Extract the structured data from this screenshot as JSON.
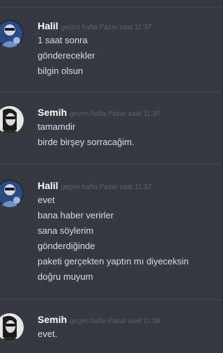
{
  "messages": [
    {
      "username": "Halil",
      "timestamp": "geçen hafta Pazar saat 11:37",
      "avatar_icon": "halil-avatar-icon",
      "lines": [
        "1 saat sonra",
        "gönderecekler",
        "bilgin olsun"
      ]
    },
    {
      "username": "Semih",
      "timestamp": "geçen hafta Pazar saat 11:37",
      "avatar_icon": "semih-avatar-icon",
      "lines": [
        "tamamdir",
        "birde birşey sorracağim."
      ]
    },
    {
      "username": "Halil",
      "timestamp": "geçen hafta Pazar saat 11:37",
      "avatar_icon": "halil-avatar-icon",
      "lines": [
        "evet",
        "bana haber verirler",
        "sana söylerim",
        "gönderdiğinde",
        "paketi gerçekten yaptın mı diyeceksin",
        "doğru muyum"
      ]
    },
    {
      "username": "Semih",
      "timestamp": "geçen hafta Pazar saat 11:38",
      "avatar_icon": "semih-avatar-icon",
      "lines": [
        "evet."
      ]
    }
  ],
  "colors": {
    "background": "#36393f",
    "divider": "#42454b",
    "username": "#ffffff",
    "timestamp": "#5d6068",
    "message_text": "#dcddde"
  }
}
